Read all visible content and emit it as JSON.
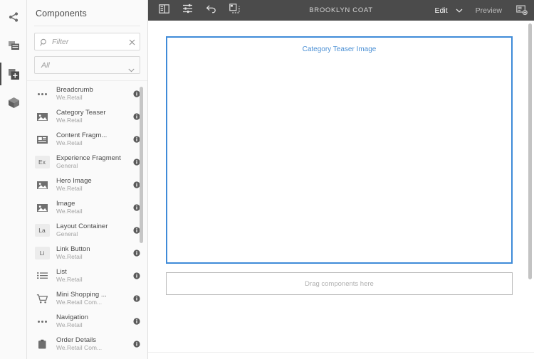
{
  "rail": {
    "items": [
      {
        "name": "site-assets",
        "icon": "share-icon",
        "selected": false
      },
      {
        "name": "page-information",
        "icon": "page-properties-icon",
        "selected": false
      },
      {
        "name": "components",
        "icon": "components-icon",
        "selected": true
      },
      {
        "name": "assets",
        "icon": "package-icon",
        "selected": false
      }
    ]
  },
  "panel": {
    "title": "Components",
    "filter": {
      "value": "",
      "placeholder": "Filter",
      "clear_label": "×"
    },
    "group_select": {
      "value": "All"
    },
    "items": [
      {
        "title": "Breadcrumb",
        "group": "We.Retail",
        "icon": "ellipsis-icon",
        "badge": ""
      },
      {
        "title": "Category Teaser",
        "group": "We.Retail",
        "icon": "image-icon",
        "badge": ""
      },
      {
        "title": "Content Fragm...",
        "group": "We.Retail",
        "icon": "content-fragment-icon",
        "badge": ""
      },
      {
        "title": "Experience Fragment",
        "group": "General",
        "icon": "text-badge",
        "badge": "Ex"
      },
      {
        "title": "Hero Image",
        "group": "We.Retail",
        "icon": "image-icon",
        "badge": ""
      },
      {
        "title": "Image",
        "group": "We.Retail",
        "icon": "image-icon",
        "badge": ""
      },
      {
        "title": "Layout Container",
        "group": "General",
        "icon": "text-badge",
        "badge": "La"
      },
      {
        "title": "Link Button",
        "group": "We.Retail",
        "icon": "text-badge",
        "badge": "Li"
      },
      {
        "title": "List",
        "group": "We.Retail",
        "icon": "list-icon",
        "badge": ""
      },
      {
        "title": "Mini Shopping ...",
        "group": "We.Retail Com...",
        "icon": "cart-icon",
        "badge": ""
      },
      {
        "title": "Navigation",
        "group": "We.Retail",
        "icon": "ellipsis-icon",
        "badge": ""
      },
      {
        "title": "Order Details",
        "group": "We.Retail Com...",
        "icon": "clipboard-icon",
        "badge": ""
      }
    ],
    "info_tooltip": "i"
  },
  "toolbar": {
    "page_title": "BROOKLYN COAT",
    "buttons": [
      {
        "name": "toggle-side-panel",
        "icon": "side-panel-icon"
      },
      {
        "name": "page-settings",
        "icon": "sliders-icon"
      },
      {
        "name": "undo",
        "icon": "undo-icon"
      },
      {
        "name": "layers",
        "icon": "layers-icon"
      }
    ],
    "mode_label": "Edit",
    "preview_label": "Preview",
    "page_info_icon": "page-info-icon",
    "colors": {
      "bar": "#4b4b4b",
      "title": "#d6d6d6",
      "active": "#ffffff",
      "inactive": "#bdbdbd"
    }
  },
  "canvas": {
    "selected_component_label": "Category Teaser Image",
    "dropzone_label": "Drag components here",
    "selection_color": "#3f8bd8",
    "label_color": "#4a8fd4"
  }
}
